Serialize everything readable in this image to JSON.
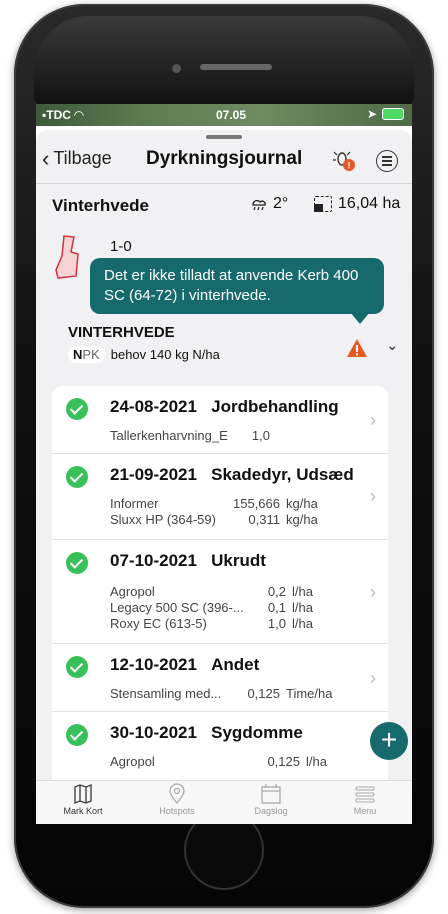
{
  "status_bar": {
    "carrier": "TDC",
    "time": "07.05"
  },
  "nav": {
    "back_label": "Tilbage",
    "title": "Dyrkningsjournal"
  },
  "field": {
    "name": "Vinterhvede",
    "temperature": "2°",
    "area": "16,04 ha",
    "code": "1-0"
  },
  "warning_tooltip": "Det er ikke tilladt at anvende Kerb 400 SC (64-72) i vinterhvede.",
  "crop": {
    "title": "VINTERHVEDE",
    "npk_n": "N",
    "npk_pk": "PK",
    "npk_text": "behov 140 kg N/ha"
  },
  "entries": [
    {
      "date": "24-08-2021",
      "type": "Jordbehandling",
      "lines": [
        {
          "product": "Tallerkenharvning_E",
          "value": "1,0",
          "unit": ""
        }
      ]
    },
    {
      "date": "21-09-2021",
      "type": "Skadedyr, Udsæd",
      "lines": [
        {
          "product": "Informer",
          "value": "155,666",
          "unit": "kg/ha"
        },
        {
          "product": "Sluxx HP (364-59)",
          "value": "0,311",
          "unit": "kg/ha"
        }
      ]
    },
    {
      "date": "07-10-2021",
      "type": "Ukrudt",
      "lines": [
        {
          "product": "Agropol",
          "value": "0,2",
          "unit": "l/ha"
        },
        {
          "product": "Legacy 500 SC (396-...",
          "value": "0,1",
          "unit": "l/ha"
        },
        {
          "product": "Roxy EC (613-5)",
          "value": "1,0",
          "unit": "l/ha"
        }
      ]
    },
    {
      "date": "12-10-2021",
      "type": "Andet",
      "lines": [
        {
          "product": "Stensamling med...",
          "value": "0,125",
          "unit": "Time/ha"
        }
      ]
    },
    {
      "date": "30-10-2021",
      "type": "Sygdomme",
      "lines": [
        {
          "product": "Agropol",
          "value": "0,125",
          "unit": "l/ha"
        }
      ]
    }
  ],
  "fab_label": "+",
  "tabs": [
    {
      "label": "Mark Kort",
      "icon": "map-icon"
    },
    {
      "label": "Hotspots",
      "icon": "location-pin-icon"
    },
    {
      "label": "Dagslog",
      "icon": "calendar-icon"
    },
    {
      "label": "Menu",
      "icon": "menu-icon"
    }
  ],
  "colors": {
    "accent": "#176a6c",
    "check": "#39c05a",
    "warning": "#e55a24"
  }
}
